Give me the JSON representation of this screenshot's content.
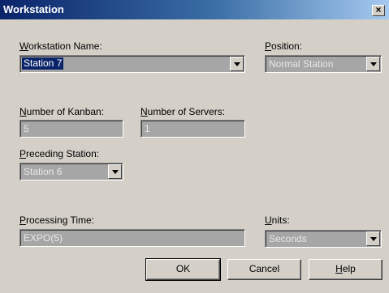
{
  "window": {
    "title": "Workstation",
    "close_glyph": "×"
  },
  "workstation_name": {
    "label": "Workstation Name:",
    "value": "Station 7"
  },
  "position": {
    "label": "Position:",
    "value": "Normal Station"
  },
  "num_kanban": {
    "label": "Number of Kanban:",
    "value": "5"
  },
  "num_servers": {
    "label": "Number of Servers:",
    "value": "1"
  },
  "preceding_station": {
    "label": "Preceding Station:",
    "value": "Station 6"
  },
  "processing_time": {
    "label": "Processing Time:",
    "value": "EXPO(5)"
  },
  "units": {
    "label": "Units:",
    "value": "Seconds"
  },
  "buttons": {
    "ok": "OK",
    "cancel": "Cancel",
    "help": "Help"
  }
}
